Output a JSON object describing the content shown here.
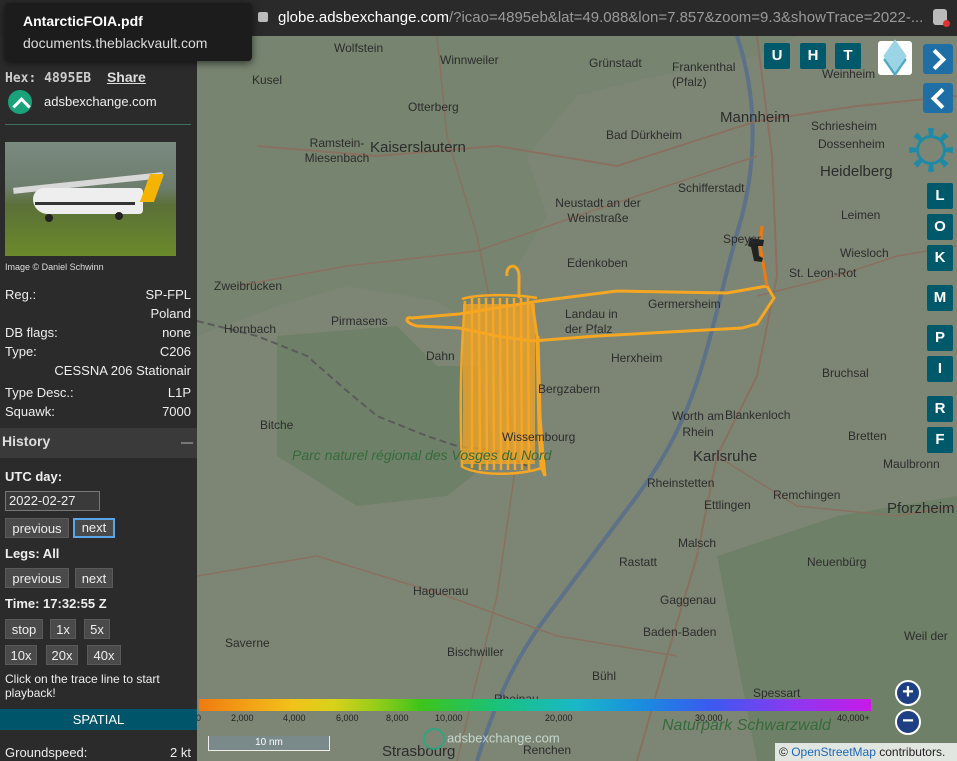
{
  "browser": {
    "tooltip_title": "AntarcticFOIA.pdf",
    "tooltip_host": "documents.theblackvault.com",
    "url_host": "globe.adsbexchange.com",
    "url_path": "/?icao=4895eb&lat=49.088&lon=7.857&zoom=9.3&showTrace=2022-..."
  },
  "sidebar": {
    "hex_label": "Hex:",
    "hex_value": "4895EB",
    "share_label": "Share",
    "site_link": "adsbexchange.com",
    "photo_credit": "Image © Daniel Schwinn",
    "info": [
      {
        "key": "Reg.:",
        "value": "SP-FPL"
      },
      {
        "key": "",
        "value": "Poland"
      },
      {
        "key": "DB flags:",
        "value": "none"
      },
      {
        "key": "Type:",
        "value": "C206"
      },
      {
        "key": "",
        "value": "CESSNA 206 Stationair"
      },
      {
        "key": "Type Desc.:",
        "value": "L1P"
      },
      {
        "key": "Squawk:",
        "value": "7000"
      }
    ],
    "history_title": "History",
    "utc_day_label": "UTC day:",
    "utc_day_value": "2022-02-27",
    "day_prev": "previous",
    "day_next": "next",
    "legs_label": "Legs: All",
    "legs_prev": "previous",
    "legs_next": "next",
    "time_label": "Time: 17:32:55 Z",
    "speed_buttons": [
      "stop",
      "1x",
      "5x",
      "10x",
      "20x",
      "40x"
    ],
    "play_hint": "Click on the trace line to start playback!",
    "spatial_label": "SPATIAL",
    "groundspeed_label": "Groundspeed:",
    "groundspeed_value": "2 kt"
  },
  "map": {
    "towns": [
      {
        "name": "Kusel"
      },
      {
        "name": "Wolfstein"
      },
      {
        "name": "Winnweiler"
      },
      {
        "name": "Grünstadt"
      },
      {
        "name": "Frankenthal (Pfalz)"
      },
      {
        "name": "Mannheim"
      },
      {
        "name": "Weinheim"
      },
      {
        "name": "Otterberg"
      },
      {
        "name": "Bad Dürkheim"
      },
      {
        "name": "Schriesheim"
      },
      {
        "name": "Dossenheim"
      },
      {
        "name": "Ramstein-Miesenbach"
      },
      {
        "name": "Kaiserslautern"
      },
      {
        "name": "Heidelberg"
      },
      {
        "name": "Schifferstadt"
      },
      {
        "name": "Neustadt an der Weinstraße"
      },
      {
        "name": "Leimen"
      },
      {
        "name": "Edenkoben"
      },
      {
        "name": "Speyer"
      },
      {
        "name": "Wiesloch"
      },
      {
        "name": "St. Leon-Rot"
      },
      {
        "name": "Zweibrücken"
      },
      {
        "name": "Germersheim"
      },
      {
        "name": "Pirmasens"
      },
      {
        "name": "Landau in der Pfalz"
      },
      {
        "name": "Hornbach"
      },
      {
        "name": "Dahn"
      },
      {
        "name": "Herxheim"
      },
      {
        "name": "Bruchsal"
      },
      {
        "name": "Bergzabern"
      },
      {
        "name": "Worth am Rhein"
      },
      {
        "name": "Blankenloch"
      },
      {
        "name": "Bitche"
      },
      {
        "name": "Wissembourg"
      },
      {
        "name": "Bretten"
      },
      {
        "name": "Karlsruhe"
      },
      {
        "name": "Maulbronn"
      },
      {
        "name": "Rheinstetten"
      },
      {
        "name": "Ettlingen"
      },
      {
        "name": "Remchingen"
      },
      {
        "name": "Pforzheim"
      },
      {
        "name": "Malsch"
      },
      {
        "name": "Rastatt"
      },
      {
        "name": "Neuenbürg"
      },
      {
        "name": "Haguenau"
      },
      {
        "name": "Gaggenau"
      },
      {
        "name": "Bischwiller"
      },
      {
        "name": "Baden-Baden"
      },
      {
        "name": "Saverne"
      },
      {
        "name": "Bühl"
      },
      {
        "name": "Weil der"
      },
      {
        "name": "Spessart"
      },
      {
        "name": "Strasbourg"
      },
      {
        "name": "Rheinau"
      },
      {
        "name": "Renchen"
      }
    ],
    "park_label": "Parc naturel régional des Vosges du Nord",
    "forest_label": "Naturpark Schwarzwald",
    "ctrl_top": [
      "U",
      "H",
      "T"
    ],
    "ctrl_side": [
      "L",
      "O",
      "K",
      "M",
      "P",
      "I",
      "R",
      "F"
    ],
    "altitude_ticks": [
      "0",
      "2,000",
      "4,000",
      "6,000",
      "8,000",
      "10,000",
      "20,000",
      "30,000",
      "40,000+"
    ],
    "scale_label": "10 nm",
    "watermark": "adsbexchange.com",
    "attribution_prefix": "©",
    "attribution_link": "OpenStreetMap",
    "attribution_suffix": "contributors."
  },
  "icons": {
    "layers": "layers-icon",
    "gear": "gear-icon",
    "next_aircraft": "chevron-right-icon",
    "prev_aircraft": "chevron-left-icon",
    "zoom_in": "zoom-in-icon",
    "zoom_out": "zoom-out-icon",
    "aircraft": "aircraft-icon"
  },
  "colors": {
    "trace": "#f5a623",
    "trace_recent": "#f07a10",
    "control_teal": "#00596b",
    "link_blue": "#1a66b8"
  }
}
